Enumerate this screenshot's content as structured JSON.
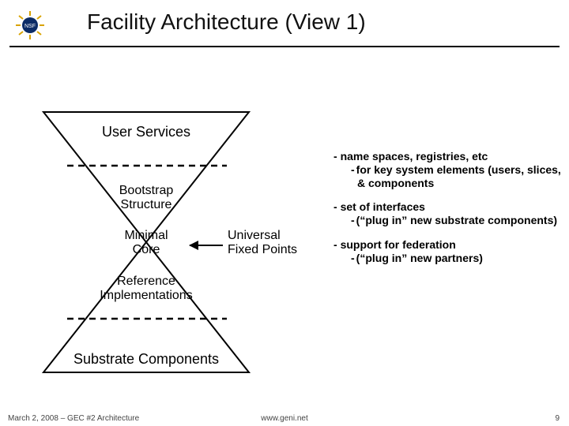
{
  "header": {
    "title": "Facility Architecture (View 1)",
    "logo_name": "NSF"
  },
  "diagram": {
    "top_label": "User Services",
    "upper_mid_label": "Bootstrap\nStructure",
    "center_label": "Minimal\nCore",
    "lower_mid_label": "Reference\nImplementations",
    "bottom_label": "Substrate Components",
    "arrow_label": "Universal\nFixed Points"
  },
  "bullets": [
    {
      "head": "name spaces, registries, etc",
      "subs": [
        "for key system elements (users, slices, & components"
      ]
    },
    {
      "head": "set of interfaces",
      "subs": [
        "(“plug in” new substrate components)"
      ]
    },
    {
      "head": "support for federation",
      "subs": [
        "(“plug in” new partners)"
      ]
    }
  ],
  "footer": {
    "left": "March 2, 2008 – GEC #2 Architecture",
    "center": "www.geni.net",
    "page": "9"
  }
}
